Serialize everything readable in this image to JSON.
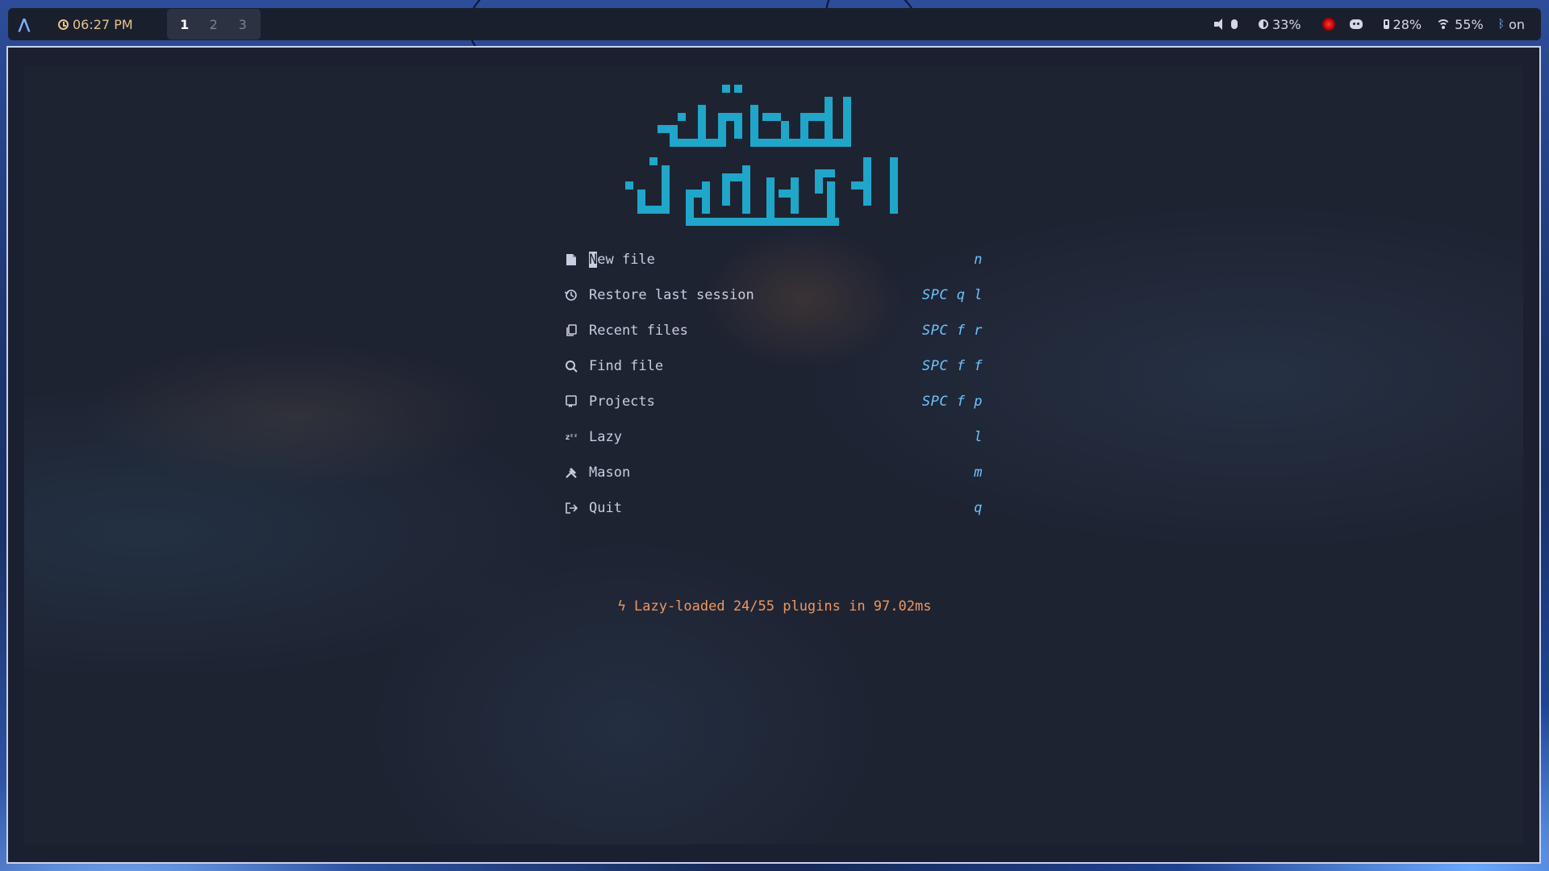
{
  "topbar": {
    "launcher_icon": "arch-icon",
    "time": "06:27 PM",
    "workspaces": [
      "1",
      "2",
      "3"
    ],
    "active_workspace": "1",
    "brightness": "33%",
    "battery": "28%",
    "wifi": "55%",
    "bluetooth": "on"
  },
  "dashboard": {
    "logo_text": "العلم قبل القول والعمل",
    "logo_color": "#1fa6c9",
    "items": [
      {
        "icon": "file-icon",
        "label": "New file",
        "key": "n"
      },
      {
        "icon": "history-icon",
        "label": "Restore last session",
        "key": "SPC q l"
      },
      {
        "icon": "copy-icon",
        "label": "Recent files",
        "key": "SPC f r"
      },
      {
        "icon": "search-icon",
        "label": "Find file",
        "key": "SPC f f"
      },
      {
        "icon": "repo-icon",
        "label": "Projects",
        "key": "SPC f p"
      },
      {
        "icon": "sleep-icon",
        "label": "Lazy",
        "key": "l"
      },
      {
        "icon": "tools-icon",
        "label": "Mason",
        "key": "m"
      },
      {
        "icon": "exit-icon",
        "label": "Quit",
        "key": "q"
      }
    ],
    "footer": "Lazy-loaded 24/55 plugins in 97.02ms",
    "accent_color": "#6ec3ff",
    "footer_color": "#f0975f"
  }
}
